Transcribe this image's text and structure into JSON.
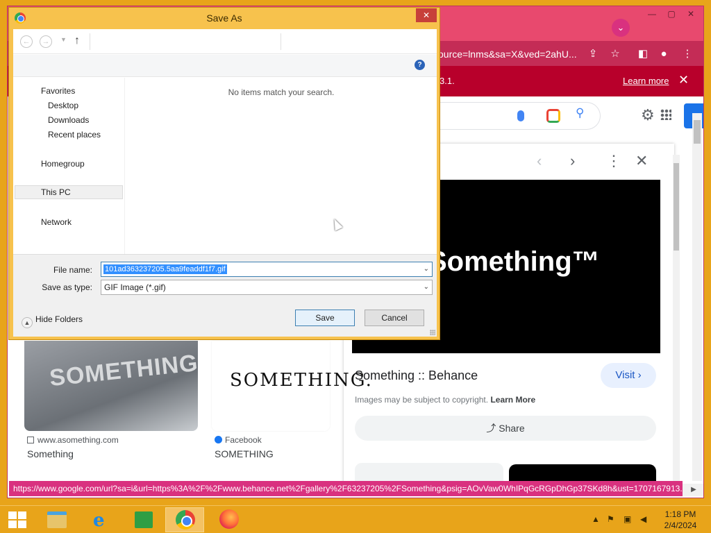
{
  "dialog": {
    "title": "Save As",
    "nav": {
      "favorites": "Favorites",
      "desktop": "Desktop",
      "downloads": "Downloads",
      "recent_places": "Recent places",
      "homegroup": "Homegroup",
      "this_pc": "This PC",
      "network": "Network"
    },
    "empty_message": "No items match your search.",
    "file_name_label": "File name:",
    "file_name_value": "101ad363237205.5aa9feaddf1f7.gif",
    "save_type_label": "Save as type:",
    "save_type_value": "GIF Image (*.gif)",
    "hide_folders": "Hide Folders",
    "save_button": "Save",
    "cancel_button": "Cancel"
  },
  "browser": {
    "omnibox_tail": "ource=lnms&sa=X&ved=2ahU...",
    "banner_text": "3.1.",
    "banner_link": "Learn more",
    "preview": {
      "image_text": "Something™",
      "title": "Something :: Behance",
      "visit": "Visit",
      "copyright": "Images may be subject to copyright.",
      "copyright_link": "Learn More",
      "share": "Share"
    },
    "results": [
      {
        "image_text": "SOMETHING",
        "source": "www.asomething.com",
        "title": "Something"
      },
      {
        "image_text": "SOMETHING.",
        "source": "Facebook",
        "title": "SOMETHING"
      }
    ],
    "status_url": "https://www.google.com/url?sa=i&url=https%3A%2F%2Fwww.behance.net%2Fgallery%2F63237205%2FSomething&psig=AOvVaw0WhIPqGcRGpDhGp37SKd8h&ust=1707167913..."
  },
  "taskbar": {
    "time": "1:18 PM",
    "date": "2/4/2024"
  },
  "colors": {
    "desktop": "#e8a41a",
    "chrome_frame": "#e8496e",
    "banner": "#b8002b",
    "selection": "#3390ff"
  }
}
